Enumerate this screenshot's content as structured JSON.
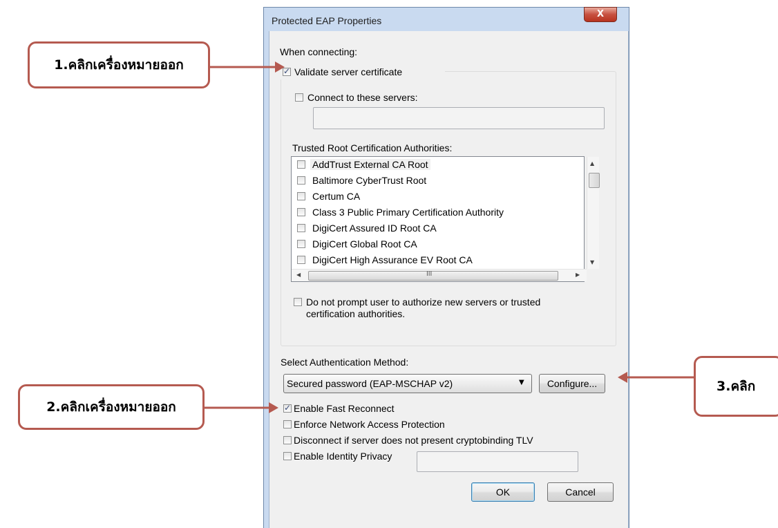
{
  "dialog": {
    "title": "Protected EAP Properties",
    "close_glyph": "X",
    "when_connecting_label": "When connecting:",
    "validate_cert": {
      "label": "Validate server certificate",
      "checked": true
    },
    "connect_servers": {
      "label": "Connect to these servers:",
      "checked": false,
      "value": ""
    },
    "trusted_root_label": "Trusted Root Certification Authorities:",
    "ca_list": [
      {
        "label": "AddTrust External CA Root",
        "checked": false
      },
      {
        "label": "Baltimore CyberTrust Root",
        "checked": false
      },
      {
        "label": "Certum CA",
        "checked": false
      },
      {
        "label": "Class 3 Public Primary Certification Authority",
        "checked": false
      },
      {
        "label": "DigiCert Assured ID Root CA",
        "checked": false
      },
      {
        "label": "DigiCert Global Root CA",
        "checked": false
      },
      {
        "label": "DigiCert High Assurance EV Root CA",
        "checked": false
      }
    ],
    "hscroll_mid_glyph": "III",
    "do_not_prompt": {
      "label_line1": "Do not prompt user to authorize new servers or trusted",
      "label_line2": "certification authorities.",
      "checked": false
    },
    "select_auth_label": "Select Authentication Method:",
    "auth_method_value": "Secured password (EAP-MSCHAP v2)",
    "configure_button": "Configure...",
    "enable_fast_reconnect": {
      "label": "Enable Fast Reconnect",
      "checked": true
    },
    "enforce_nap": {
      "label": "Enforce Network Access Protection",
      "checked": false
    },
    "disconnect_tlv": {
      "label": "Disconnect if server does not present cryptobinding TLV",
      "checked": false
    },
    "identity_privacy": {
      "label": "Enable Identity Privacy",
      "checked": false,
      "value": ""
    },
    "ok_button": "OK",
    "cancel_button": "Cancel"
  },
  "callouts": {
    "step1": "1.คลิกเครื่องหมายออก",
    "step2": "2.คลิกเครื่องหมายออก",
    "step3": "3.คลิก",
    "color": "#b55a50"
  },
  "icons": {
    "close": "close-icon",
    "dropdown": "chevron-down-icon",
    "scroll_up": "scroll-up-arrow-icon",
    "scroll_down": "scroll-down-arrow-icon",
    "scroll_left": "scroll-left-arrow-icon",
    "scroll_right": "scroll-right-arrow-icon"
  }
}
